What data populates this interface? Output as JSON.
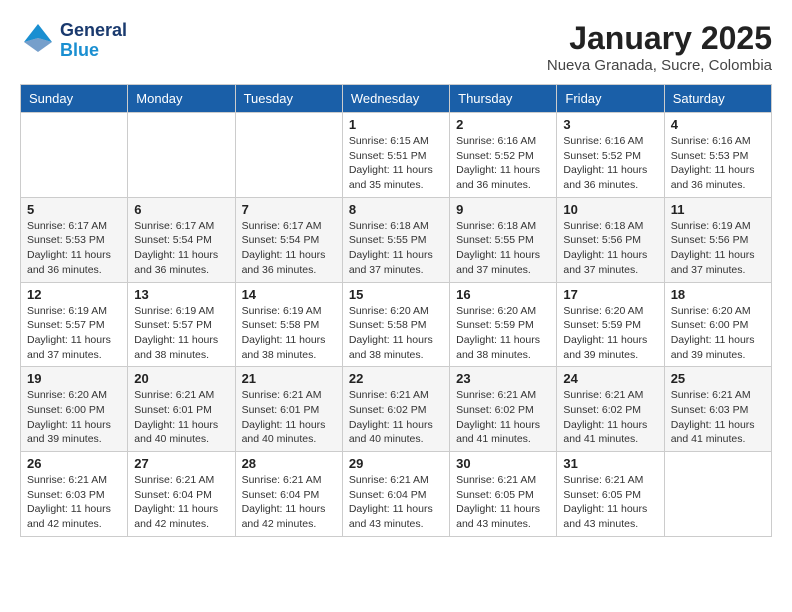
{
  "logo": {
    "line1": "General",
    "line2": "Blue"
  },
  "title": "January 2025",
  "location": "Nueva Granada, Sucre, Colombia",
  "weekdays": [
    "Sunday",
    "Monday",
    "Tuesday",
    "Wednesday",
    "Thursday",
    "Friday",
    "Saturday"
  ],
  "weeks": [
    [
      {
        "day": null,
        "info": null
      },
      {
        "day": null,
        "info": null
      },
      {
        "day": null,
        "info": null
      },
      {
        "day": "1",
        "sunrise": "6:15 AM",
        "sunset": "5:51 PM",
        "daylight": "11 hours and 35 minutes."
      },
      {
        "day": "2",
        "sunrise": "6:16 AM",
        "sunset": "5:52 PM",
        "daylight": "11 hours and 36 minutes."
      },
      {
        "day": "3",
        "sunrise": "6:16 AM",
        "sunset": "5:52 PM",
        "daylight": "11 hours and 36 minutes."
      },
      {
        "day": "4",
        "sunrise": "6:16 AM",
        "sunset": "5:53 PM",
        "daylight": "11 hours and 36 minutes."
      }
    ],
    [
      {
        "day": "5",
        "sunrise": "6:17 AM",
        "sunset": "5:53 PM",
        "daylight": "11 hours and 36 minutes."
      },
      {
        "day": "6",
        "sunrise": "6:17 AM",
        "sunset": "5:54 PM",
        "daylight": "11 hours and 36 minutes."
      },
      {
        "day": "7",
        "sunrise": "6:17 AM",
        "sunset": "5:54 PM",
        "daylight": "11 hours and 36 minutes."
      },
      {
        "day": "8",
        "sunrise": "6:18 AM",
        "sunset": "5:55 PM",
        "daylight": "11 hours and 37 minutes."
      },
      {
        "day": "9",
        "sunrise": "6:18 AM",
        "sunset": "5:55 PM",
        "daylight": "11 hours and 37 minutes."
      },
      {
        "day": "10",
        "sunrise": "6:18 AM",
        "sunset": "5:56 PM",
        "daylight": "11 hours and 37 minutes."
      },
      {
        "day": "11",
        "sunrise": "6:19 AM",
        "sunset": "5:56 PM",
        "daylight": "11 hours and 37 minutes."
      }
    ],
    [
      {
        "day": "12",
        "sunrise": "6:19 AM",
        "sunset": "5:57 PM",
        "daylight": "11 hours and 37 minutes."
      },
      {
        "day": "13",
        "sunrise": "6:19 AM",
        "sunset": "5:57 PM",
        "daylight": "11 hours and 38 minutes."
      },
      {
        "day": "14",
        "sunrise": "6:19 AM",
        "sunset": "5:58 PM",
        "daylight": "11 hours and 38 minutes."
      },
      {
        "day": "15",
        "sunrise": "6:20 AM",
        "sunset": "5:58 PM",
        "daylight": "11 hours and 38 minutes."
      },
      {
        "day": "16",
        "sunrise": "6:20 AM",
        "sunset": "5:59 PM",
        "daylight": "11 hours and 38 minutes."
      },
      {
        "day": "17",
        "sunrise": "6:20 AM",
        "sunset": "5:59 PM",
        "daylight": "11 hours and 39 minutes."
      },
      {
        "day": "18",
        "sunrise": "6:20 AM",
        "sunset": "6:00 PM",
        "daylight": "11 hours and 39 minutes."
      }
    ],
    [
      {
        "day": "19",
        "sunrise": "6:20 AM",
        "sunset": "6:00 PM",
        "daylight": "11 hours and 39 minutes."
      },
      {
        "day": "20",
        "sunrise": "6:21 AM",
        "sunset": "6:01 PM",
        "daylight": "11 hours and 40 minutes."
      },
      {
        "day": "21",
        "sunrise": "6:21 AM",
        "sunset": "6:01 PM",
        "daylight": "11 hours and 40 minutes."
      },
      {
        "day": "22",
        "sunrise": "6:21 AM",
        "sunset": "6:02 PM",
        "daylight": "11 hours and 40 minutes."
      },
      {
        "day": "23",
        "sunrise": "6:21 AM",
        "sunset": "6:02 PM",
        "daylight": "11 hours and 41 minutes."
      },
      {
        "day": "24",
        "sunrise": "6:21 AM",
        "sunset": "6:02 PM",
        "daylight": "11 hours and 41 minutes."
      },
      {
        "day": "25",
        "sunrise": "6:21 AM",
        "sunset": "6:03 PM",
        "daylight": "11 hours and 41 minutes."
      }
    ],
    [
      {
        "day": "26",
        "sunrise": "6:21 AM",
        "sunset": "6:03 PM",
        "daylight": "11 hours and 42 minutes."
      },
      {
        "day": "27",
        "sunrise": "6:21 AM",
        "sunset": "6:04 PM",
        "daylight": "11 hours and 42 minutes."
      },
      {
        "day": "28",
        "sunrise": "6:21 AM",
        "sunset": "6:04 PM",
        "daylight": "11 hours and 42 minutes."
      },
      {
        "day": "29",
        "sunrise": "6:21 AM",
        "sunset": "6:04 PM",
        "daylight": "11 hours and 43 minutes."
      },
      {
        "day": "30",
        "sunrise": "6:21 AM",
        "sunset": "6:05 PM",
        "daylight": "11 hours and 43 minutes."
      },
      {
        "day": "31",
        "sunrise": "6:21 AM",
        "sunset": "6:05 PM",
        "daylight": "11 hours and 43 minutes."
      },
      {
        "day": null,
        "info": null
      }
    ]
  ]
}
